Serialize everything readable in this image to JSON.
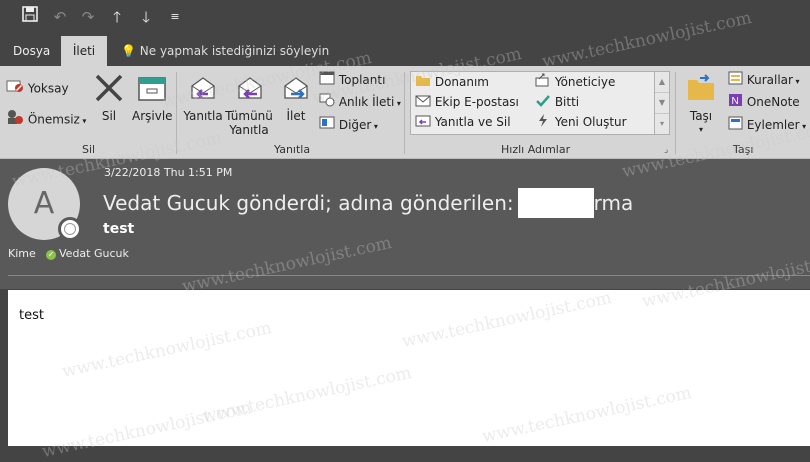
{
  "quick_access": {
    "icons": [
      "save-icon",
      "undo-icon",
      "redo-icon",
      "arrow-up-icon",
      "arrow-down-icon",
      "customize-icon"
    ]
  },
  "tabs": {
    "dosya": "Dosya",
    "ileti": "İleti",
    "tell_me": "Ne yapmak istediğinizi söyleyin"
  },
  "ribbon": {
    "sil_group": {
      "label": "Sil",
      "yoksay": "Yoksay",
      "onemsiz": "Önemsiz",
      "sil": "Sil",
      "arsivle": "Arşivle"
    },
    "yanitla_group": {
      "label": "Yanıtla",
      "yanitla": "Yanıtla",
      "tumunu_yanitla_1": "Tümünü",
      "tumunu_yanitla_2": "Yanıtla",
      "ilet": "İlet",
      "toplanti": "Toplantı",
      "anlik_ileti": "Anlık İleti",
      "diger": "Diğer"
    },
    "hizli_adimlar": {
      "label": "Hızlı Adımlar",
      "items": [
        "Donanım",
        "Yöneticiye",
        "Ekip E-postası",
        "Bitti",
        "Yanıtla ve Sil",
        "Yeni Oluştur"
      ]
    },
    "tasi_group": {
      "label": "Taşı",
      "tasi": "Taşı",
      "kurallar": "Kurallar",
      "onenote": "OneNote",
      "eylemler": "Eylemler"
    }
  },
  "message": {
    "avatar_letter": "A",
    "date": "3/22/2018 Thu 1:51 PM",
    "subject_from": "Vedat Gucuk gönderdi; adına gönderilen:",
    "subject_suffix": "rma",
    "subject_line": "test",
    "to_label": "Kime",
    "recipient": "Vedat Gucuk",
    "body": "test"
  },
  "watermark": {
    "text": "www.techknowlojist.com"
  },
  "colors": {
    "chrome": "#444444",
    "ribbon": "#d5d5d5",
    "header": "#595959",
    "accent_green": "#8bc34a"
  }
}
